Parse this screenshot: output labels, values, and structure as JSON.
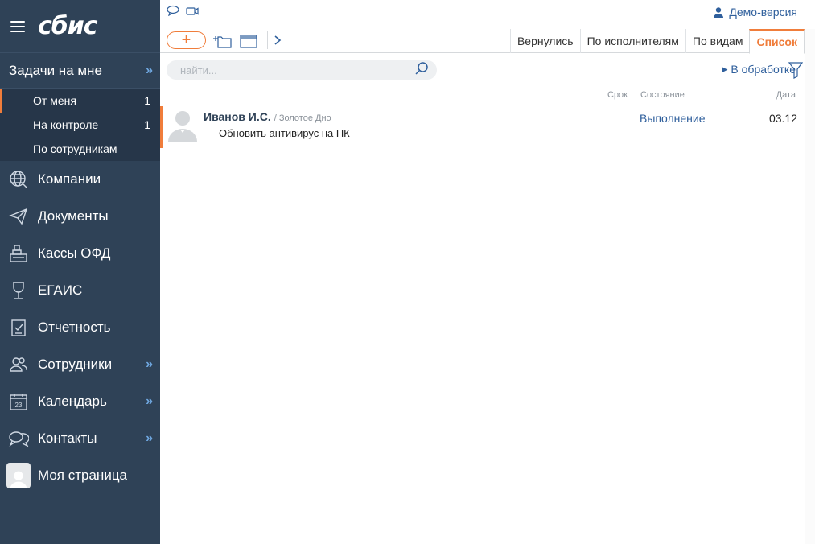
{
  "sidebar": {
    "logo": "сбис",
    "section": {
      "title": "Задачи на мне",
      "items": [
        {
          "label": "От меня",
          "count": "1"
        },
        {
          "label": "На контроле",
          "count": "1"
        },
        {
          "label": "По сотрудникам",
          "count": ""
        }
      ]
    },
    "nav": [
      {
        "label": "Компании",
        "icon": "globe-icon"
      },
      {
        "label": "Документы",
        "icon": "paper-plane-icon"
      },
      {
        "label": "Кассы ОФД",
        "icon": "cash-register-icon"
      },
      {
        "label": "ЕГАИС",
        "icon": "wine-glass-icon"
      },
      {
        "label": "Отчетность",
        "icon": "report-icon"
      },
      {
        "label": "Сотрудники",
        "icon": "people-icon"
      },
      {
        "label": "Календарь",
        "icon": "calendar-icon",
        "calendar_day": "23"
      },
      {
        "label": "Контакты",
        "icon": "chat-bubbles-icon"
      },
      {
        "label": "Моя страница",
        "icon": "avatar"
      }
    ]
  },
  "header": {
    "user": "Демо-версия"
  },
  "toolbar": {
    "add_label": "+",
    "tabs": [
      "Вернулись",
      "По исполнителям",
      "По видам",
      "Список"
    ],
    "active_tab": "Список"
  },
  "search": {
    "placeholder": "найти..."
  },
  "filter": {
    "label": "В обработке"
  },
  "table": {
    "columns": {
      "deadline": "Срок",
      "state": "Состояние",
      "date": "Дата"
    },
    "rows": [
      {
        "author": "Иванов И.С.",
        "org": "/ Золотое Дно",
        "task": "Обновить антивирус на ПК",
        "state": "Выполнение",
        "date": "03.12"
      }
    ]
  },
  "colors": {
    "sidebar": "#2f4257",
    "accent": "#f07d3b",
    "link": "#2f5f9c"
  }
}
